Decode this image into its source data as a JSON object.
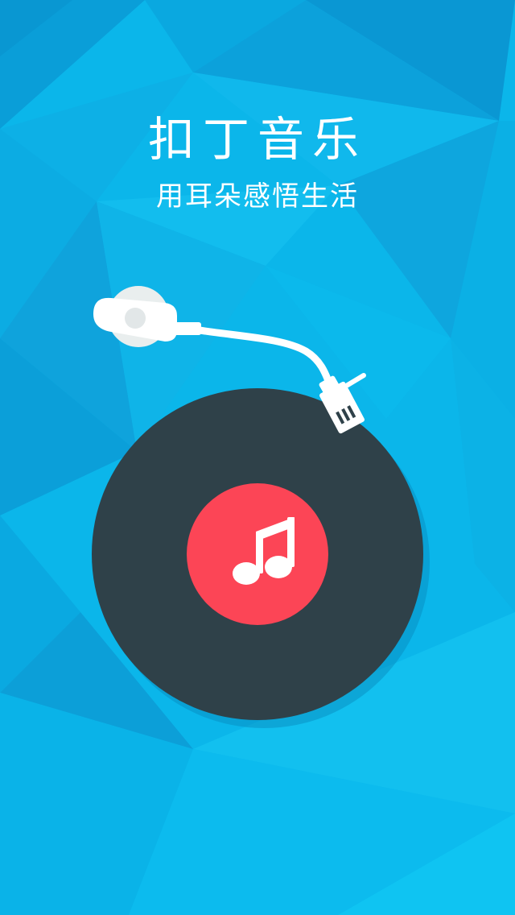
{
  "app": {
    "title": "扣丁音乐",
    "slogan": "用耳朵感悟生活"
  },
  "icons": {
    "record": "vinyl-record-icon",
    "note": "music-note-icon",
    "tonearm": "tonearm-icon"
  },
  "colors": {
    "background": "#0bb6ea",
    "record": "#2f4149",
    "label": "#fc4556",
    "tonearm": "#ffffff"
  }
}
